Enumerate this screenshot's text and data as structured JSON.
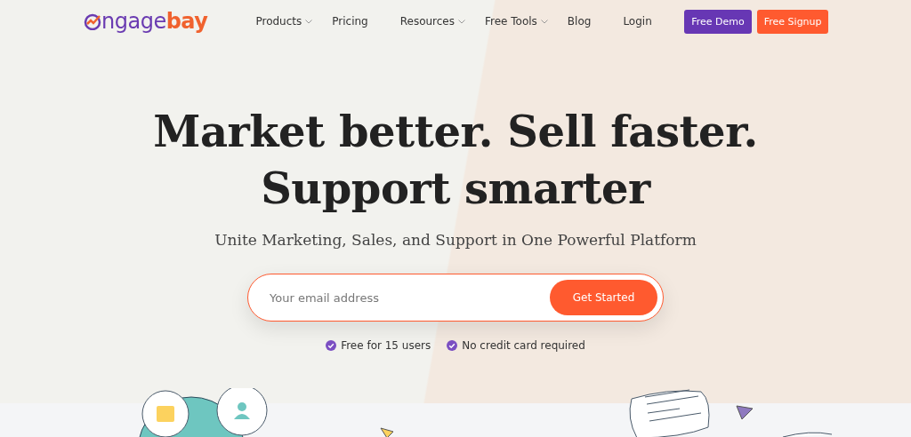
{
  "logo": {
    "primary": "ngage",
    "accent": "bay"
  },
  "nav": [
    {
      "label": "Products",
      "has_dropdown": true
    },
    {
      "label": "Pricing",
      "has_dropdown": false
    },
    {
      "label": "Resources",
      "has_dropdown": true
    },
    {
      "label": "Free Tools",
      "has_dropdown": true
    },
    {
      "label": "Blog",
      "has_dropdown": false
    },
    {
      "label": "Login",
      "has_dropdown": false
    }
  ],
  "header_buttons": [
    {
      "label": "Free Demo",
      "kind": "demo"
    },
    {
      "label": "Free Signup",
      "kind": "signup"
    }
  ],
  "hero": {
    "title_lines": [
      "Market better. Sell faster.",
      "Support smarter"
    ],
    "subtitle": "Unite Marketing, Sales, and Support in One Powerful Platform",
    "signup_form": {
      "placeholder": "Your email address",
      "button": "Get Started"
    },
    "perks": [
      "Free for 15 users",
      "No credit card required"
    ]
  }
}
